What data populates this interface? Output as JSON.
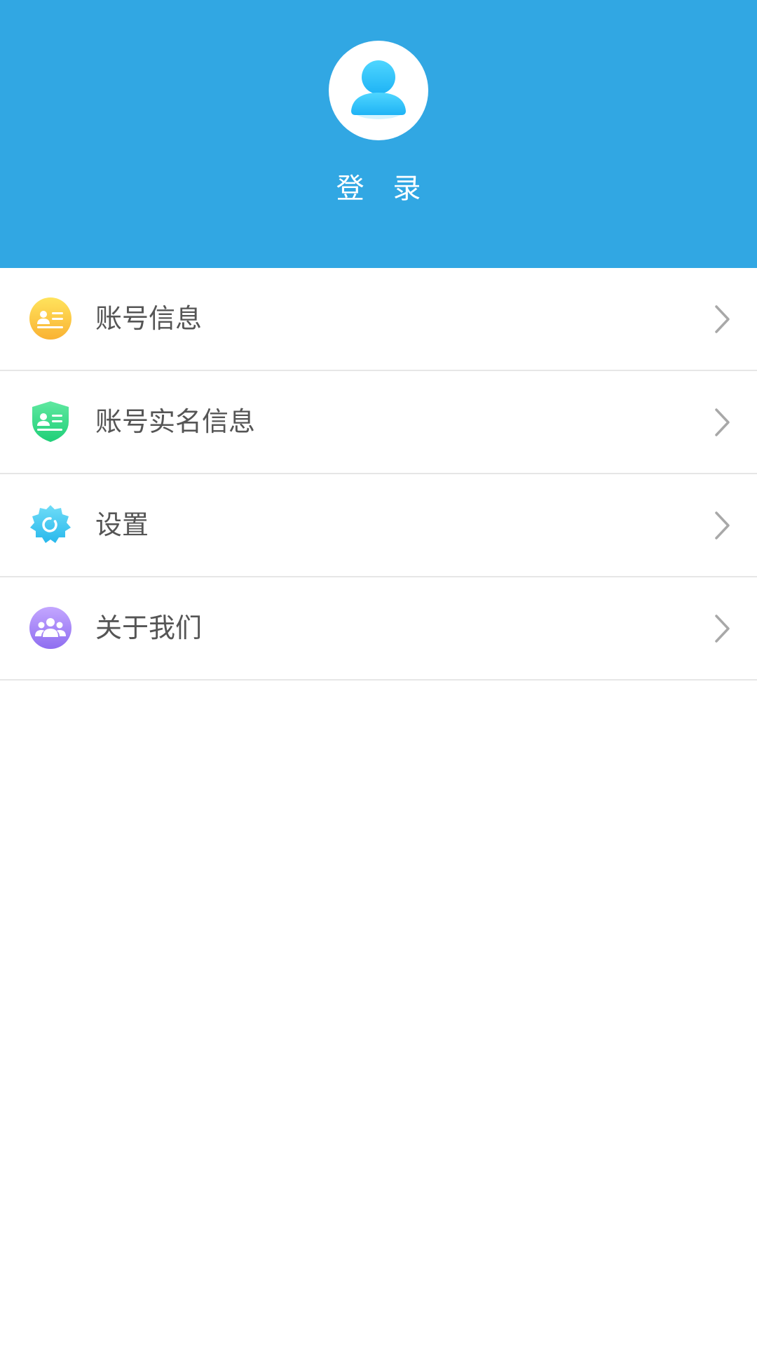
{
  "header": {
    "login_label": "登 录",
    "background_color": "#31a7e3",
    "avatar_icon": "user-avatar-icon"
  },
  "menu": {
    "items": [
      {
        "label": "账号信息",
        "icon": "account-card-icon",
        "icon_color": "#fbc02d"
      },
      {
        "label": "账号实名信息",
        "icon": "shield-id-icon",
        "icon_color": "#3ddc84"
      },
      {
        "label": "设置",
        "icon": "gear-icon",
        "icon_color": "#3ec6f0"
      },
      {
        "label": "关于我们",
        "icon": "group-icon",
        "icon_color": "#a07ef0"
      }
    ],
    "chevron_icon": "chevron-right-icon"
  }
}
